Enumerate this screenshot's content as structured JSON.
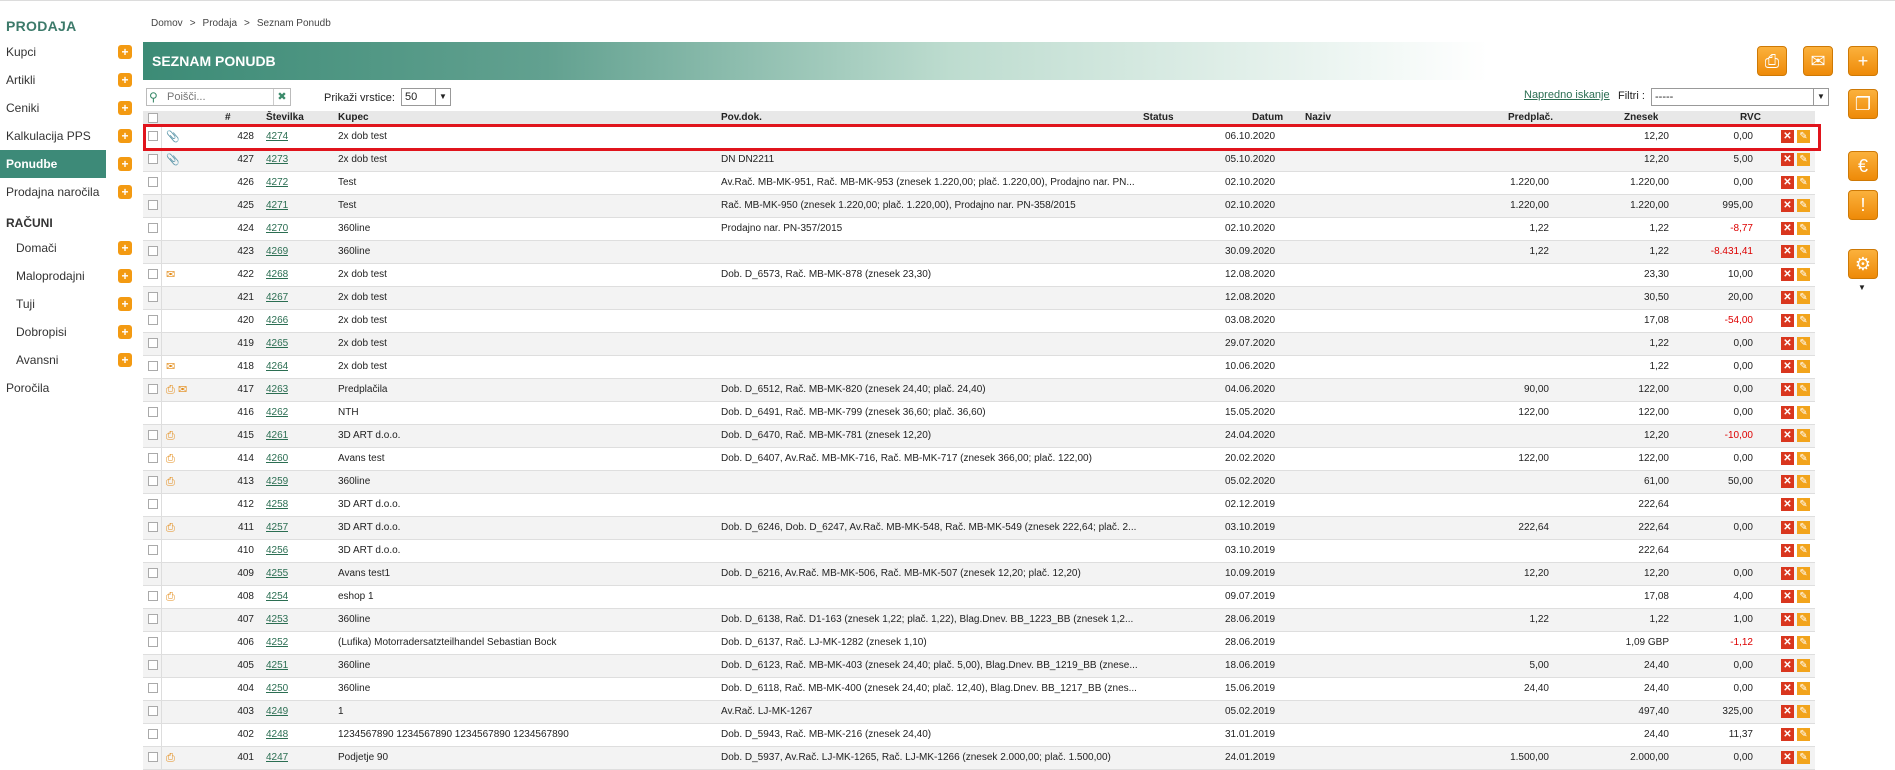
{
  "sidebar": {
    "heading": "PRODAJA",
    "items": [
      {
        "label": "Kupci"
      },
      {
        "label": "Artikli"
      },
      {
        "label": "Ceniki"
      },
      {
        "label": "Kalkulacija PPS"
      },
      {
        "label": "Ponudbe",
        "active": true
      },
      {
        "label": "Prodajna naročila"
      }
    ],
    "heading2": "RAČUNI",
    "sub_items": [
      {
        "label": "Domači"
      },
      {
        "label": "Maloprodajni"
      },
      {
        "label": "Tuji"
      },
      {
        "label": "Dobropisi"
      },
      {
        "label": "Avansni"
      }
    ],
    "last_item": "Poročila"
  },
  "breadcrumb": [
    "Domov",
    ">",
    "Prodaja",
    ">",
    "Seznam Ponudb"
  ],
  "page_title": "SEZNAM PONUDB",
  "toolbar": {
    "search_placeholder": "Poišči...",
    "rows_label": "Prikaži vrstice:",
    "rows_value": "50",
    "advanced_search": "Napredno iskanje",
    "filter_label": "Filtri :",
    "filter_value": "-----"
  },
  "icons": {
    "print": "printer-icon",
    "mail": "envelope-icon",
    "add": "plus-icon",
    "copy": "copy-icon",
    "euro": "euro-icon",
    "warning": "exclamation-icon",
    "settings": "gear-icon"
  },
  "columns": {
    "hash": "#",
    "stevilka": "Številka",
    "kupec": "Kupec",
    "povdok": "Pov.dok.",
    "status": "Status",
    "datum": "Datum",
    "naziv": "Naziv",
    "predplac": "Predplač.",
    "znesek": "Znesek",
    "rvc": "RVC"
  },
  "rows": [
    {
      "n": "428",
      "st": "4274",
      "kupec": "2x dob test",
      "pov": "",
      "datum": "06.10.2020",
      "pred": "",
      "zn": "12,20",
      "rvc": "0,00",
      "neg": false,
      "icons": "clip"
    },
    {
      "n": "427",
      "st": "4273",
      "kupec": "2x dob test",
      "pov": "DN DN2211",
      "datum": "05.10.2020",
      "pred": "",
      "zn": "12,20",
      "rvc": "5,00",
      "neg": false,
      "icons": "clip"
    },
    {
      "n": "426",
      "st": "4272",
      "kupec": "Test",
      "pov": "Av.Rač. MB-MK-951, Rač. MB-MK-953 (znesek 1.220,00; plač. 1.220,00), Prodajno nar. PN...",
      "datum": "02.10.2020",
      "pred": "1.220,00",
      "zn": "1.220,00",
      "rvc": "0,00",
      "neg": false,
      "icons": ""
    },
    {
      "n": "425",
      "st": "4271",
      "kupec": "Test",
      "pov": "Rač. MB-MK-950 (znesek 1.220,00; plač. 1.220,00), Prodajno nar. PN-358/2015",
      "datum": "02.10.2020",
      "pred": "1.220,00",
      "zn": "1.220,00",
      "rvc": "995,00",
      "neg": false,
      "icons": ""
    },
    {
      "n": "424",
      "st": "4270",
      "kupec": "360line",
      "pov": "Prodajno nar. PN-357/2015",
      "datum": "02.10.2020",
      "pred": "1,22",
      "zn": "1,22",
      "rvc": "-8,77",
      "neg": true,
      "icons": ""
    },
    {
      "n": "423",
      "st": "4269",
      "kupec": "360line",
      "pov": "",
      "datum": "30.09.2020",
      "pred": "1,22",
      "zn": "1,22",
      "rvc": "-8.431,41",
      "neg": true,
      "icons": ""
    },
    {
      "n": "422",
      "st": "4268",
      "kupec": "2x dob test",
      "pov": "Dob. D_6573, Rač. MB-MK-878 (znesek 23,30)",
      "datum": "12.08.2020",
      "pred": "",
      "zn": "23,30",
      "rvc": "10,00",
      "neg": false,
      "icons": "mail"
    },
    {
      "n": "421",
      "st": "4267",
      "kupec": "2x dob test",
      "pov": "",
      "datum": "12.08.2020",
      "pred": "",
      "zn": "30,50",
      "rvc": "20,00",
      "neg": false,
      "icons": ""
    },
    {
      "n": "420",
      "st": "4266",
      "kupec": "2x dob test",
      "pov": "",
      "datum": "03.08.2020",
      "pred": "",
      "zn": "17,08",
      "rvc": "-54,00",
      "neg": true,
      "icons": ""
    },
    {
      "n": "419",
      "st": "4265",
      "kupec": "2x dob test",
      "pov": "",
      "datum": "29.07.2020",
      "pred": "",
      "zn": "1,22",
      "rvc": "0,00",
      "neg": false,
      "icons": ""
    },
    {
      "n": "418",
      "st": "4264",
      "kupec": "2x dob test",
      "pov": "",
      "datum": "10.06.2020",
      "pred": "",
      "zn": "1,22",
      "rvc": "0,00",
      "neg": false,
      "icons": "mail"
    },
    {
      "n": "417",
      "st": "4263",
      "kupec": "Predplačila",
      "pov": "Dob. D_6512, Rač. MB-MK-820 (znesek 24,40; plač. 24,40)",
      "datum": "04.06.2020",
      "pred": "90,00",
      "zn": "122,00",
      "rvc": "0,00",
      "neg": false,
      "icons": "print-mail"
    },
    {
      "n": "416",
      "st": "4262",
      "kupec": "NTH",
      "pov": "Dob. D_6491, Rač. MB-MK-799 (znesek 36,60; plač. 36,60)",
      "datum": "15.05.2020",
      "pred": "122,00",
      "zn": "122,00",
      "rvc": "0,00",
      "neg": false,
      "icons": ""
    },
    {
      "n": "415",
      "st": "4261",
      "kupec": "3D ART d.o.o.",
      "pov": "Dob. D_6470, Rač. MB-MK-781 (znesek 12,20)",
      "datum": "24.04.2020",
      "pred": "",
      "zn": "12,20",
      "rvc": "-10,00",
      "neg": true,
      "icons": "print"
    },
    {
      "n": "414",
      "st": "4260",
      "kupec": "Avans test",
      "pov": "Dob. D_6407, Av.Rač. MB-MK-716, Rač. MB-MK-717 (znesek 366,00; plač. 122,00)",
      "datum": "20.02.2020",
      "pred": "122,00",
      "zn": "122,00",
      "rvc": "0,00",
      "neg": false,
      "icons": "print"
    },
    {
      "n": "413",
      "st": "4259",
      "kupec": "360line",
      "pov": "",
      "datum": "05.02.2020",
      "pred": "",
      "zn": "61,00",
      "rvc": "50,00",
      "neg": false,
      "icons": "print"
    },
    {
      "n": "412",
      "st": "4258",
      "kupec": "3D ART d.o.o.",
      "pov": "",
      "datum": "02.12.2019",
      "pred": "",
      "zn": "222,64",
      "rvc": "",
      "neg": false,
      "icons": ""
    },
    {
      "n": "411",
      "st": "4257",
      "kupec": "3D ART d.o.o.",
      "pov": "Dob. D_6246, Dob. D_6247, Av.Rač. MB-MK-548, Rač. MB-MK-549 (znesek 222,64; plač. 2...",
      "datum": "03.10.2019",
      "pred": "222,64",
      "zn": "222,64",
      "rvc": "0,00",
      "neg": false,
      "icons": "print"
    },
    {
      "n": "410",
      "st": "4256",
      "kupec": "3D ART d.o.o.",
      "pov": "",
      "datum": "03.10.2019",
      "pred": "",
      "zn": "222,64",
      "rvc": "",
      "neg": false,
      "icons": ""
    },
    {
      "n": "409",
      "st": "4255",
      "kupec": "Avans test1",
      "pov": "Dob. D_6216, Av.Rač. MB-MK-506, Rač. MB-MK-507 (znesek 12,20; plač. 12,20)",
      "datum": "10.09.2019",
      "pred": "12,20",
      "zn": "12,20",
      "rvc": "0,00",
      "neg": false,
      "icons": ""
    },
    {
      "n": "408",
      "st": "4254",
      "kupec": "eshop 1",
      "pov": "",
      "datum": "09.07.2019",
      "pred": "",
      "zn": "17,08",
      "rvc": "4,00",
      "neg": false,
      "icons": "print"
    },
    {
      "n": "407",
      "st": "4253",
      "kupec": "360line",
      "pov": "Dob. D_6138, Rač. D1-163 (znesek 1,22; plač. 1,22), Blag.Dnev. BB_1223_BB (znesek 1,2...",
      "datum": "28.06.2019",
      "pred": "1,22",
      "zn": "1,22",
      "rvc": "1,00",
      "neg": false,
      "icons": ""
    },
    {
      "n": "406",
      "st": "4252",
      "kupec": "(Lufika) Motorradersatzteilhandel Sebastian Bock",
      "pov": "Dob. D_6137, Rač. LJ-MK-1282 (znesek 1,10)",
      "datum": "28.06.2019",
      "pred": "",
      "zn": "1,09 GBP",
      "rvc": "-1,12",
      "neg": true,
      "icons": ""
    },
    {
      "n": "405",
      "st": "4251",
      "kupec": "360line",
      "pov": "Dob. D_6123, Rač. MB-MK-403 (znesek 24,40; plač. 5,00), Blag.Dnev. BB_1219_BB (znese...",
      "datum": "18.06.2019",
      "pred": "5,00",
      "zn": "24,40",
      "rvc": "0,00",
      "neg": false,
      "icons": ""
    },
    {
      "n": "404",
      "st": "4250",
      "kupec": "360line",
      "pov": "Dob. D_6118, Rač. MB-MK-400 (znesek 24,40; plač. 12,40), Blag.Dnev. BB_1217_BB (znes...",
      "datum": "15.06.2019",
      "pred": "24,40",
      "zn": "24,40",
      "rvc": "0,00",
      "neg": false,
      "icons": ""
    },
    {
      "n": "403",
      "st": "4249",
      "kupec": "1",
      "pov": "Av.Rač. LJ-MK-1267",
      "datum": "05.02.2019",
      "pred": "",
      "zn": "497,40",
      "rvc": "325,00",
      "neg": false,
      "icons": ""
    },
    {
      "n": "402",
      "st": "4248",
      "kupec": "1234567890 1234567890 1234567890 1234567890",
      "pov": "Dob. D_5943, Rač. MB-MK-216 (znesek 24,40)",
      "datum": "31.01.2019",
      "pred": "",
      "zn": "24,40",
      "rvc": "11,37",
      "neg": false,
      "icons": ""
    },
    {
      "n": "401",
      "st": "4247",
      "kupec": "Podjetje 90",
      "pov": "Dob. D_5937, Av.Rač. LJ-MK-1265, Rač. LJ-MK-1266 (znesek 2.000,00; plač. 1.500,00)",
      "datum": "24.01.2019",
      "pred": "1.500,00",
      "zn": "2.000,00",
      "rvc": "0,00",
      "neg": false,
      "icons": "print"
    }
  ]
}
